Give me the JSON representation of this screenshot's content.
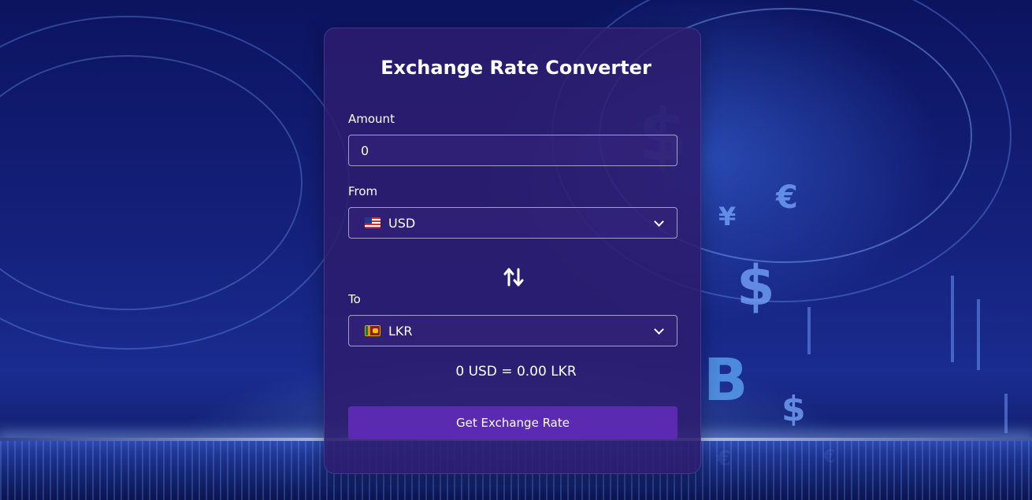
{
  "converter": {
    "title": "Exchange Rate Converter",
    "amount_label": "Amount",
    "amount_value": "0",
    "from_label": "From",
    "from_currency": "USD",
    "from_flag": "us-flag-icon",
    "to_label": "To",
    "to_currency": "LKR",
    "to_flag": "lk-flag-icon",
    "swap_icon": "swap-arrows-icon",
    "result_text": "0 USD = 0.00 LKR",
    "button_label": "Get Exchange Rate"
  },
  "background": {
    "symbols": [
      "€",
      "¥",
      "$",
      "$",
      "B",
      "$",
      "€",
      "€"
    ]
  },
  "colors": {
    "card": "#2c1c6e",
    "button": "#5a2bb0",
    "text": "#ffffff"
  }
}
